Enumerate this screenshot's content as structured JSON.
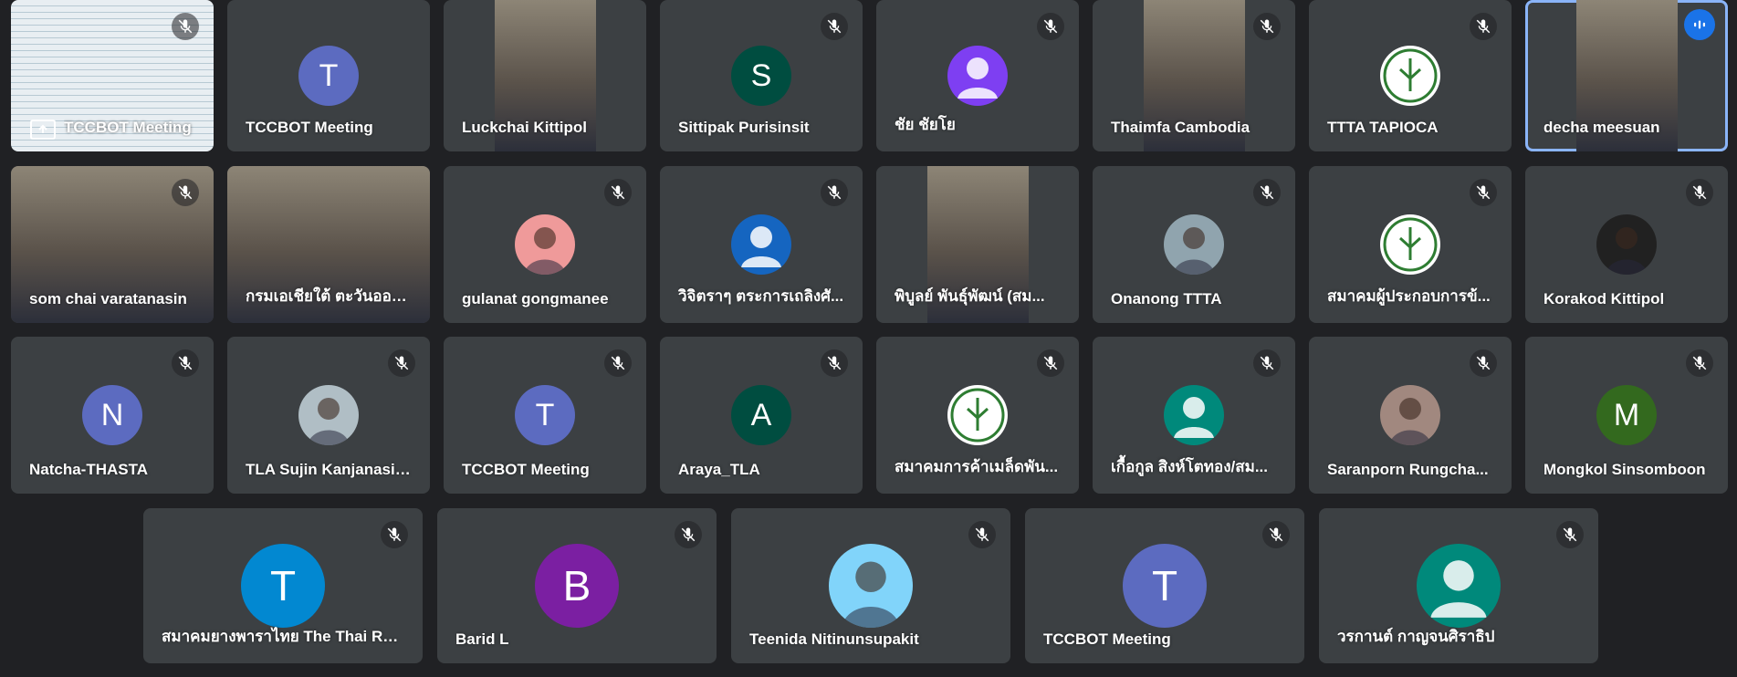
{
  "colors": {
    "background": "#202124",
    "tile": "#3c4043",
    "speaking_outline": "#8ab4f8"
  },
  "participants": [
    {
      "name": "TCCBOT Meeting",
      "kind": "presentation",
      "muted": true
    },
    {
      "name": "TCCBOT Meeting",
      "kind": "letter",
      "letter": "T",
      "color": "#5c6bc0",
      "muted": false
    },
    {
      "name": "Luckchai Kittipol",
      "kind": "video",
      "muted": false
    },
    {
      "name": "Sittipak Purisinsit",
      "kind": "letter",
      "letter": "S",
      "color": "#004d40",
      "muted": true
    },
    {
      "name": "ชัย ชัยโย",
      "kind": "person",
      "color": "#7e3ff2",
      "muted": true
    },
    {
      "name": "Thaimfa Cambodia",
      "kind": "video",
      "muted": true
    },
    {
      "name": "TTTA TAPIOCA",
      "kind": "logo",
      "color": "#ffffff",
      "muted": true
    },
    {
      "name": "decha meesuan",
      "kind": "video",
      "muted": false,
      "speaking": true
    },
    {
      "name": "som chai varatanasin",
      "kind": "video",
      "muted": true
    },
    {
      "name": "กรมเอเชียใต้ ตะวันออก...",
      "kind": "video",
      "muted": false
    },
    {
      "name": "gulanat gongmanee",
      "kind": "photo",
      "color": "#ef9a9a",
      "muted": true
    },
    {
      "name": "วิจิตราๆ ตระการเถลิงศั...",
      "kind": "person",
      "color": "#1565c0",
      "muted": true
    },
    {
      "name": "พิบูลย์ พันธ์ุพัฒน์ (สม...",
      "kind": "video",
      "muted": false
    },
    {
      "name": "Onanong TTTA",
      "kind": "photo",
      "color": "#90a4ae",
      "muted": true
    },
    {
      "name": "สมาคมผู้ประกอบการข้...",
      "kind": "logo",
      "color": "#ffffff",
      "muted": true
    },
    {
      "name": "Korakod Kittipol",
      "kind": "photo",
      "color": "#212121",
      "muted": true
    },
    {
      "name": "Natcha-THASTA",
      "kind": "letter",
      "letter": "N",
      "color": "#5c6bc0",
      "muted": true
    },
    {
      "name": "TLA Sujin Kanjanasir...",
      "kind": "photo",
      "color": "#b0bec5",
      "muted": true
    },
    {
      "name": "TCCBOT Meeting",
      "kind": "letter",
      "letter": "T",
      "color": "#5c6bc0",
      "muted": true
    },
    {
      "name": "Araya_TLA",
      "kind": "letter",
      "letter": "A",
      "color": "#004d40",
      "muted": true
    },
    {
      "name": "สมาคมการค้าเมล็ดพัน...",
      "kind": "logo",
      "color": "#ffffff",
      "muted": true
    },
    {
      "name": "เกื้อกูล สิงห์โตทอง/สม...",
      "kind": "person",
      "color": "#00897b",
      "muted": true
    },
    {
      "name": "Saranporn Rungcha...",
      "kind": "photo",
      "color": "#a1887f",
      "muted": true
    },
    {
      "name": "Mongkol Sinsomboon",
      "kind": "letter",
      "letter": "M",
      "color": "#33691e",
      "muted": true
    },
    {
      "name": "สมาคมยางพาราไทย The Thai Ru...",
      "kind": "letter",
      "letter": "T",
      "color": "#0288d1",
      "muted": true
    },
    {
      "name": "Barid L",
      "kind": "letter",
      "letter": "B",
      "color": "#7b1fa2",
      "muted": true
    },
    {
      "name": "Teenida Nitinunsupakit",
      "kind": "photo",
      "color": "#81d4fa",
      "muted": true
    },
    {
      "name": "TCCBOT Meeting",
      "kind": "letter",
      "letter": "T",
      "color": "#5c6bc0",
      "muted": true
    },
    {
      "name": "วรกานต์ กาญจนศิราธิป",
      "kind": "person",
      "color": "#00897b",
      "muted": true
    }
  ]
}
